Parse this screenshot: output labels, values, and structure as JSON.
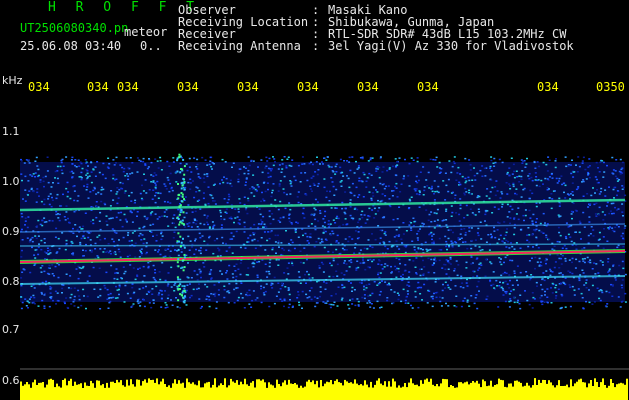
{
  "header": {
    "title": "H R O F F T",
    "filename": "UT2506080340.pn",
    "detector": "meteor",
    "datetime": "25.06.08 03:40",
    "count": "0..",
    "fields": [
      {
        "label": "Observer",
        "value": "Masaki Kano"
      },
      {
        "label": "Receiving Location",
        "value": "Shibukawa, Gunma, Japan"
      },
      {
        "label": "Receiver",
        "value": "RTL-SDR SDR# 43dB L15 103.2MHz CW"
      },
      {
        "label": "Receiving Antenna",
        "value": "3el Yagi(V) Az 330 for Vladivostok"
      }
    ]
  },
  "axis": {
    "unit": "kHz",
    "time_ticks": [
      "034",
      "034",
      "034",
      "034",
      "034",
      "034",
      "034",
      "034",
      "034",
      "0350"
    ],
    "freq_labels": [
      "1.1",
      "1.0",
      "0.9",
      "0.8",
      "0.7",
      "0.6"
    ]
  },
  "colors": {
    "header_title": "#00e000",
    "header_text": "#e8e8e8",
    "tick_text": "#ffff00",
    "power_bar": "#ffff00",
    "signal_strong": "#ff2060",
    "signal_mid": "#40ff40",
    "noise": "#1040ff"
  }
}
